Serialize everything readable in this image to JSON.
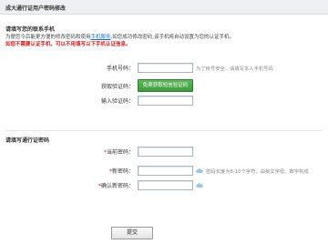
{
  "header": {
    "title": "成大通行证用户密码修改"
  },
  "phone_section": {
    "title": "请填写您的联系手机",
    "desc_prefix": "为便您今后能更方便的修改密码和使用",
    "desc_link": "手机服务",
    "desc_suffix": ",如您成功修改密码,该手机将自动设置为您的认证手机。",
    "warning": "如您不需要认证手机，可以不用填写以下手机认证信息。",
    "phone_label": "手机号码：",
    "phone_hint": "为了帐号安全，请填写本人手机号码",
    "get_code_label": "获取验证码：",
    "get_code_button": "免费获取短信验证码",
    "code_label": "输入验证码："
  },
  "password_section": {
    "title": "请填写通行证密码",
    "current_label": "当前密码：",
    "new_label": "新密码：",
    "new_hint": "密码长度为8-10个字符，由英文字母、数字构成",
    "confirm_label": "确认新密码：",
    "required_mark": "*"
  },
  "submit_label": "提交"
}
